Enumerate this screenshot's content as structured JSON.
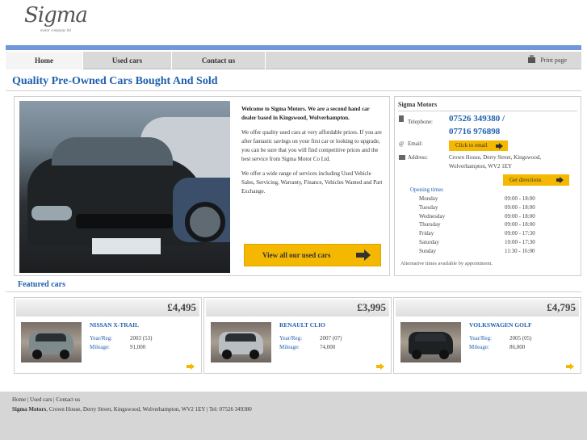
{
  "logo": {
    "text": "Sigma",
    "sub": "motor company ltd"
  },
  "nav": {
    "items": [
      "Home",
      "Used cars",
      "Contact us"
    ],
    "print_label": "Print page"
  },
  "page_title": "Quality Pre-Owned Cars Bought And Sold",
  "intro": {
    "p1_bold": "Welcome to Sigma Motors. We are a second hand car dealer based in Kingswood, Wolverhampton.",
    "p2": "We offer quality used cars at very affordable prices. If you are after fantastic savings on your first car or looking to upgrade, you can be sure that you will find competitive prices and the best service from Sigma Motor Co Ltd.",
    "p3": "We offer a wide range of services including Used Vehicle Sales, Servicing, Warranty, Finance, Vehicles Wanted and Part Exchange."
  },
  "view_all_label": "View all our used cars",
  "contact": {
    "title": "Sigma Motors",
    "telephone_label": "Telephone:",
    "phone1": "07526 349380 /",
    "phone2": "07716 976898",
    "email_label": "Email:",
    "email_button": "Click to email",
    "address_label": "Address:",
    "address_line1": "Crown House, Derry Street, Kingswood,",
    "address_line2": "Wolverhampton, WV2 1EY",
    "directions_button": "Get directions",
    "hours_title": "Opening times",
    "hours": [
      {
        "day": "Monday",
        "time": "09:00 - 18:00"
      },
      {
        "day": "Tuesday",
        "time": "09:00 - 18:00"
      },
      {
        "day": "Wednesday",
        "time": "09:00 - 18:00"
      },
      {
        "day": "Thursday",
        "time": "09:00 - 18:00"
      },
      {
        "day": "Friday",
        "time": "09:00 - 17:30"
      },
      {
        "day": "Saturday",
        "time": "10:00 - 17:30"
      },
      {
        "day": "Sunday",
        "time": "11:30 - 16:00"
      }
    ],
    "alt_times": "Alternative times available by appointment."
  },
  "featured": {
    "title": "Featured cars",
    "cars": [
      {
        "price": "£4,495",
        "name": "NISSAN X-TRAIL",
        "year_label": "Year/Reg:",
        "year": "2003 (53)",
        "mileage_label": "Mileage:",
        "mileage": "91,000",
        "body_color": "#7f8a8c"
      },
      {
        "price": "£3,995",
        "name": "RENAULT CLIO",
        "year_label": "Year/Reg:",
        "year": "2007 (07)",
        "mileage_label": "Mileage:",
        "mileage": "74,000",
        "body_color": "#b9bec2"
      },
      {
        "price": "£4,795",
        "name": "VOLKSWAGEN GOLF",
        "year_label": "Year/Reg:",
        "year": "2005 (05)",
        "mileage_label": "Mileage:",
        "mileage": "86,000",
        "body_color": "#1e2124"
      }
    ]
  },
  "footer": {
    "links": [
      "Home",
      "Used cars",
      "Contact us"
    ],
    "company": "Sigma Motors",
    "address": ", Crown House, Derry Street, Kingswood, Wolverhampton, WV2 1EY | Tel: 07526 349380"
  },
  "colors": {
    "accent_blue": "#2060b0",
    "nav_bar_blue": "#6f97d9",
    "button_yellow": "#f5b800"
  }
}
